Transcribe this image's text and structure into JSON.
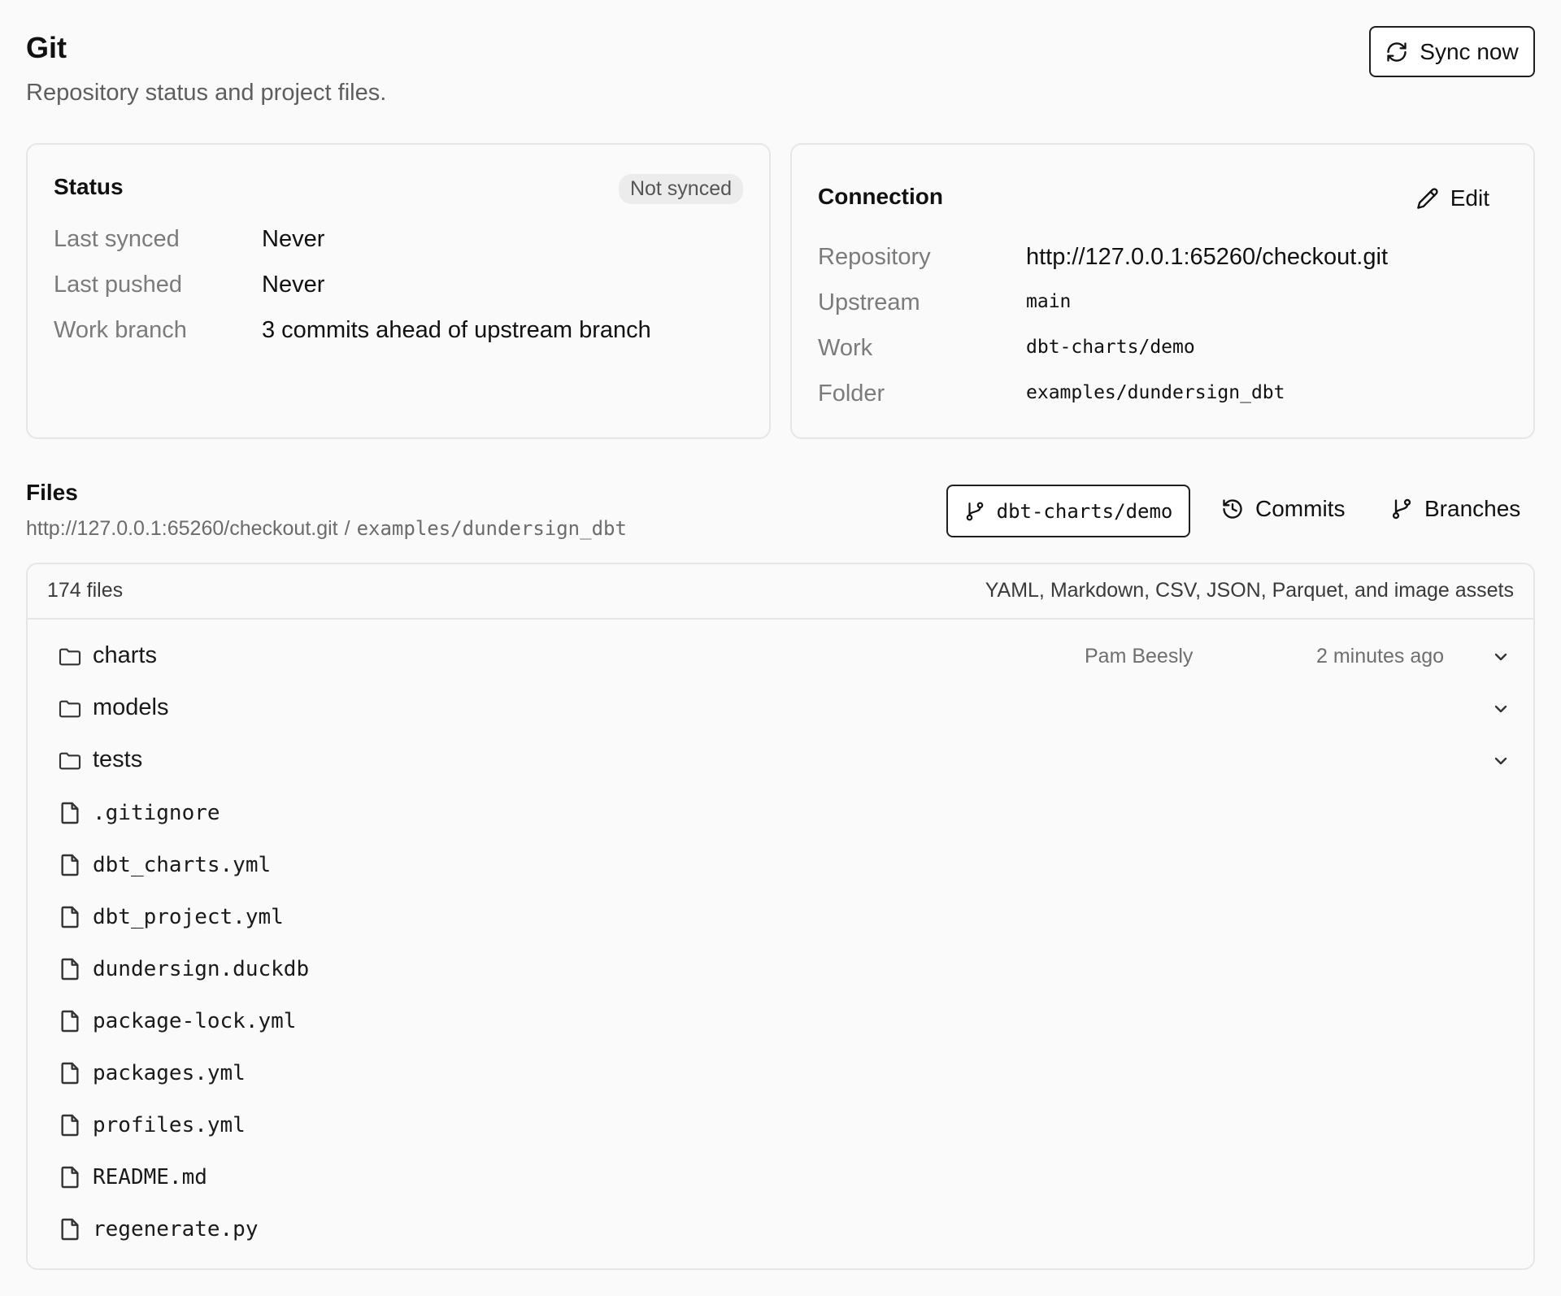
{
  "header": {
    "title": "Git",
    "subtitle": "Repository status and project files.",
    "sync_label": "Sync now"
  },
  "status": {
    "title": "Status",
    "badge": "Not synced",
    "rows": [
      {
        "label": "Last synced",
        "value": "Never"
      },
      {
        "label": "Last pushed",
        "value": "Never"
      },
      {
        "label": "Work branch",
        "value": "3 commits ahead of upstream branch"
      }
    ]
  },
  "connection": {
    "title": "Connection",
    "edit_label": "Edit",
    "rows": [
      {
        "label": "Repository",
        "value": "http://127.0.0.1:65260/checkout.git"
      },
      {
        "label": "Upstream",
        "value": "main"
      },
      {
        "label": "Work",
        "value": "dbt-charts/demo"
      },
      {
        "label": "Folder",
        "value": "examples/dundersign_dbt"
      }
    ]
  },
  "files": {
    "title": "Files",
    "path_repo": "http://127.0.0.1:65260/checkout.git",
    "path_sep": "/",
    "path_folder": "examples/dundersign_dbt",
    "branch_label": "dbt-charts/demo",
    "commits_label": "Commits",
    "branches_label": "Branches",
    "count": "174 files",
    "types": "YAML, Markdown, CSV, JSON, Parquet, and image assets",
    "items": [
      {
        "name": "charts",
        "type": "folder",
        "author": "Pam Beesly",
        "time": "2 minutes ago"
      },
      {
        "name": "models",
        "type": "folder"
      },
      {
        "name": "tests",
        "type": "folder"
      },
      {
        "name": ".gitignore",
        "type": "file"
      },
      {
        "name": "dbt_charts.yml",
        "type": "file"
      },
      {
        "name": "dbt_project.yml",
        "type": "file"
      },
      {
        "name": "dundersign.duckdb",
        "type": "file"
      },
      {
        "name": "package-lock.yml",
        "type": "file"
      },
      {
        "name": "packages.yml",
        "type": "file"
      },
      {
        "name": "profiles.yml",
        "type": "file"
      },
      {
        "name": "README.md",
        "type": "file"
      },
      {
        "name": "regenerate.py",
        "type": "file"
      }
    ]
  },
  "icons": {
    "sync": "refresh-icon",
    "edit": "pencil-icon",
    "branch": "git-branch-icon",
    "commits": "history-icon",
    "folder": "folder-icon",
    "file": "file-icon",
    "expand": "chevron-down-icon"
  }
}
